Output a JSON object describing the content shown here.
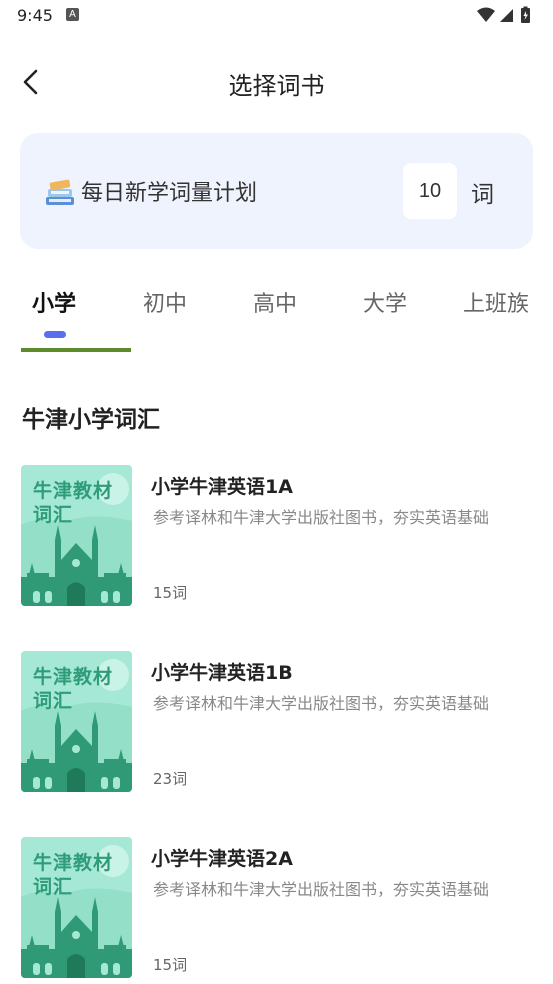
{
  "status": {
    "time": "9:45",
    "notif_letter": "A"
  },
  "header": {
    "title": "选择词书"
  },
  "plan": {
    "label": "每日新学词量计划",
    "value": "10",
    "unit": "词"
  },
  "tabs": [
    {
      "label": "小学"
    },
    {
      "label": "初中"
    },
    {
      "label": "高中"
    },
    {
      "label": "大学"
    },
    {
      "label": "上班族"
    }
  ],
  "section": {
    "title": "牛津小学词汇"
  },
  "books": [
    {
      "name": "小学牛津英语1A",
      "description": "参考译林和牛津大学出版社图书，夯实英语基础",
      "count": "15词",
      "cover_text": "牛津教材词汇"
    },
    {
      "name": "小学牛津英语1B",
      "description": "参考译林和牛津大学出版社图书，夯实英语基础",
      "count": "23词",
      "cover_text": "牛津教材词汇"
    },
    {
      "name": "小学牛津英语2A",
      "description": "参考译林和牛津大学出版社图书，夯实英语基础",
      "count": "15词",
      "cover_text": "牛津教材词汇"
    }
  ],
  "colors": {
    "accent": "#5a6ef0",
    "card_bg": "#eff3fd",
    "cover_bg": "#a6e8d6",
    "cover_text": "#2e9c78"
  }
}
